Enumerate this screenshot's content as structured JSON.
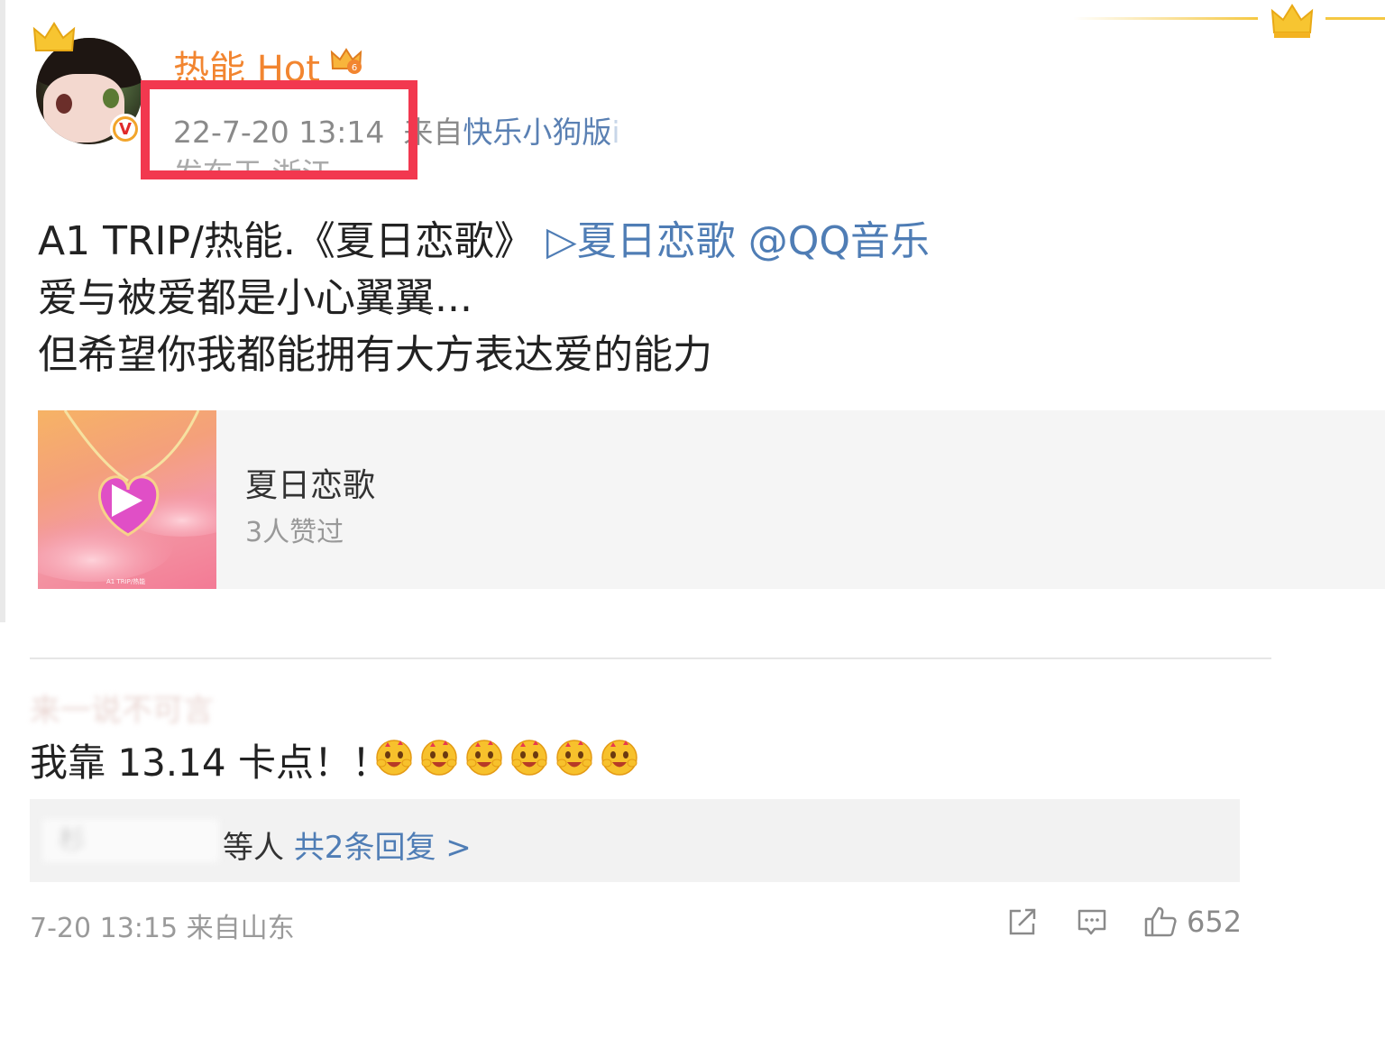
{
  "post": {
    "username": "热能 Hot",
    "timestamp": "22-7-20 13:14",
    "source_prefix": "来自",
    "source_name": "快乐小狗版",
    "source_suffix": "i",
    "location": "发布于 浙江",
    "verified_badge": "V",
    "lines": {
      "line1": "A1 TRIP/热能.《夏日恋歌》",
      "line1_link_icon": "▷",
      "line1_link": "夏日恋歌 @QQ音乐",
      "line2": "爱与被爱都是小心翼翼...",
      "line3": "但希望你我都能拥有大方表达爱的能力"
    },
    "highlight_color": "#f2384f"
  },
  "music_card": {
    "title": "夏日恋歌",
    "likes": "3人赞过",
    "cover_caption": "A1 TRIP/热能"
  },
  "comment": {
    "author_blurred": "来一说不可言",
    "text": "我靠 13.14 卡点！！",
    "emoji_icon": "heart-eyes-emoji",
    "emoji_count": 6,
    "reply_names_blurred": "杉",
    "reply_suffix": "等人",
    "reply_more": "共2条回复 >",
    "date": "7-20 13:15",
    "location": "来自山东",
    "like_count": "652"
  },
  "colors": {
    "username": "#f28530",
    "link": "#4f7db5",
    "meta": "#8a8a8a"
  }
}
